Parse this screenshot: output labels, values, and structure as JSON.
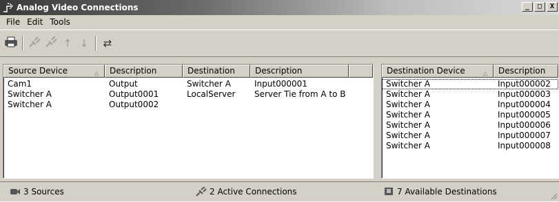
{
  "window": {
    "title": "Analog Video Connections",
    "buttons": {
      "minimize": "_",
      "maximize": "□",
      "close": "X"
    }
  },
  "menu": {
    "items": [
      {
        "label": "File"
      },
      {
        "label": "Edit"
      },
      {
        "label": "Tools"
      }
    ]
  },
  "toolbar": {
    "tools": [
      {
        "icon": "printer-icon",
        "enabled": true
      },
      {
        "icon": "connect-icon",
        "enabled": false
      },
      {
        "icon": "disconnect-icon",
        "enabled": false
      },
      {
        "icon": "arrow-up-icon",
        "enabled": false
      },
      {
        "icon": "arrow-down-icon",
        "enabled": false
      },
      {
        "icon": "swap-icon",
        "enabled": true
      }
    ]
  },
  "connections": {
    "columns": [
      "Source Device",
      "Description",
      "Destination",
      "Description",
      ""
    ],
    "rows": [
      [
        "Cam1",
        "Output",
        "Switcher A",
        "Input000001"
      ],
      [
        "Switcher A",
        "Output0001",
        "LocalServer",
        "Server Tie from A to B"
      ],
      [
        "Switcher A",
        "Output0002",
        "",
        ""
      ]
    ]
  },
  "destinations": {
    "columns": [
      "Destination Device",
      "Description"
    ],
    "rows": [
      [
        "Switcher A",
        "Input000002"
      ],
      [
        "Switcher A",
        "Input000003"
      ],
      [
        "Switcher A",
        "Input000004"
      ],
      [
        "Switcher A",
        "Input000005"
      ],
      [
        "Switcher A",
        "Input000006"
      ],
      [
        "Switcher A",
        "Input000007"
      ],
      [
        "Switcher A",
        "Input000008"
      ]
    ]
  },
  "status": {
    "sources": "3 Sources",
    "active": "2 Active Connections",
    "available": "7 Available Destinations"
  },
  "colors": {
    "window_face": "#d4d0c8",
    "title_dark": "#3a3a3a",
    "title_light": "#d9d9d9",
    "list_background": "#ffffff"
  }
}
